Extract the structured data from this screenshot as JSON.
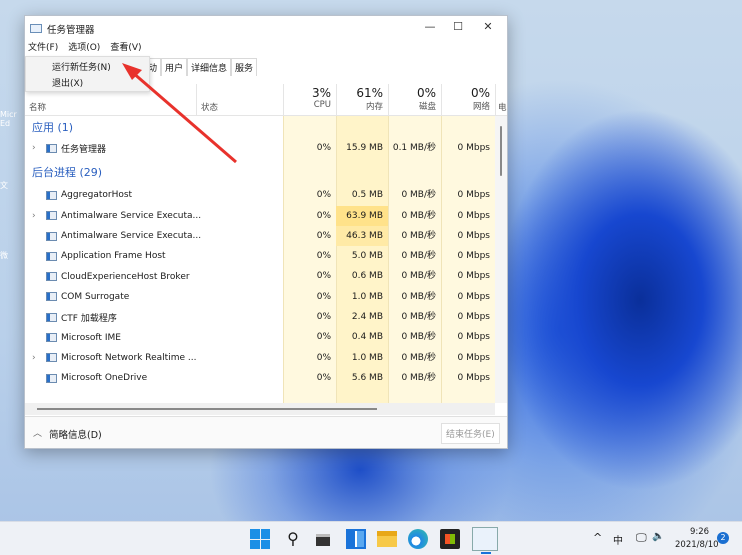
{
  "window": {
    "title": "任务管理器",
    "minimize": "—",
    "maximize": "☐",
    "close": "✕"
  },
  "menu": [
    "文件(F)",
    "选项(O)",
    "查看(V)"
  ],
  "file_menu": [
    "运行新任务(N)",
    "退出(X)"
  ],
  "tabs": [
    "动",
    "用户",
    "详细信息",
    "服务"
  ],
  "headers": {
    "name": "名称",
    "status": "状态",
    "cpu": {
      "pct": "3%",
      "label": "CPU"
    },
    "memory": {
      "pct": "61%",
      "label": "内存"
    },
    "disk": {
      "pct": "0%",
      "label": "磁盘"
    },
    "network": {
      "pct": "0%",
      "label": "网络"
    },
    "power": "电"
  },
  "groups": {
    "apps": "应用 (1)",
    "background": "后台进程 (29)"
  },
  "apps": [
    {
      "name": "任务管理器",
      "cpu": "0%",
      "mem": "15.9 MB",
      "disk": "0.1 MB/秒",
      "net": "0 Mbps",
      "expandable": true,
      "icon": "task-manager-icon"
    }
  ],
  "processes": [
    {
      "name": "AggregatorHost",
      "cpu": "0%",
      "mem": "0.5 MB",
      "disk": "0 MB/秒",
      "net": "0 Mbps",
      "expandable": false,
      "icon": "process-icon"
    },
    {
      "name": "Antimalware Service Executa...",
      "cpu": "0%",
      "mem": "63.9 MB",
      "disk": "0 MB/秒",
      "net": "0 Mbps",
      "expandable": true,
      "icon": "process-icon"
    },
    {
      "name": "Antimalware Service Executa...",
      "cpu": "0%",
      "mem": "46.3 MB",
      "disk": "0 MB/秒",
      "net": "0 Mbps",
      "expandable": false,
      "icon": "process-icon"
    },
    {
      "name": "Application Frame Host",
      "cpu": "0%",
      "mem": "5.0 MB",
      "disk": "0 MB/秒",
      "net": "0 Mbps",
      "expandable": false,
      "icon": "process-icon"
    },
    {
      "name": "CloudExperienceHost Broker",
      "cpu": "0%",
      "mem": "0.6 MB",
      "disk": "0 MB/秒",
      "net": "0 Mbps",
      "expandable": false,
      "icon": "process-icon"
    },
    {
      "name": "COM Surrogate",
      "cpu": "0%",
      "mem": "1.0 MB",
      "disk": "0 MB/秒",
      "net": "0 Mbps",
      "expandable": false,
      "icon": "process-icon"
    },
    {
      "name": "CTF 加载程序",
      "cpu": "0%",
      "mem": "2.4 MB",
      "disk": "0 MB/秒",
      "net": "0 Mbps",
      "expandable": false,
      "icon": "ctf-icon"
    },
    {
      "name": "Microsoft IME",
      "cpu": "0%",
      "mem": "0.4 MB",
      "disk": "0 MB/秒",
      "net": "0 Mbps",
      "expandable": false,
      "icon": "ime-icon"
    },
    {
      "name": "Microsoft Network Realtime ...",
      "cpu": "0%",
      "mem": "1.0 MB",
      "disk": "0 MB/秒",
      "net": "0 Mbps",
      "expandable": true,
      "icon": "process-icon"
    },
    {
      "name": "Microsoft OneDrive",
      "cpu": "0%",
      "mem": "5.6 MB",
      "disk": "0 MB/秒",
      "net": "0 Mbps",
      "expandable": false,
      "icon": "onedrive-icon"
    }
  ],
  "footer": {
    "fewer_details": "简略信息(D)",
    "end_task": "结束任务(E)"
  },
  "taskbar": {
    "ime": "中",
    "time": "9:26",
    "date": "2021/8/10",
    "notifications": "2"
  },
  "desktop_icons": [
    "Micr Ed",
    "文",
    "微"
  ],
  "colors": {
    "accent": "#2a5fbf",
    "heat_light": "#fff9df",
    "heat_mid": "#fff0b8",
    "heat_high": "#ffe28a",
    "annotation_arrow": "#e8322c"
  }
}
